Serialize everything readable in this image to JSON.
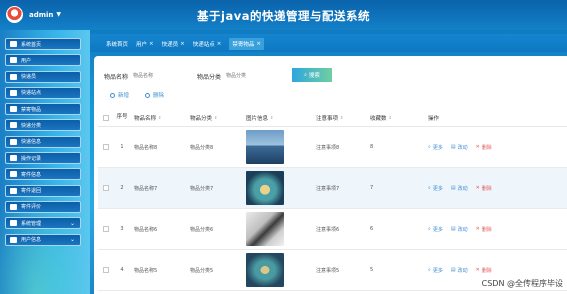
{
  "header": {
    "username": "admin",
    "title": "基于java的快递管理与配送系统"
  },
  "sidebar": {
    "items": [
      {
        "label": "系统首页",
        "icon": "home-icon"
      },
      {
        "label": "用户",
        "icon": "user-icon"
      },
      {
        "label": "快递员",
        "icon": "monitor-icon"
      },
      {
        "label": "快递站点",
        "icon": "person-icon"
      },
      {
        "label": "禁寄物品",
        "icon": "box-icon"
      },
      {
        "label": "快递分类",
        "icon": "chart-icon"
      },
      {
        "label": "快递信息",
        "icon": "list-icon"
      },
      {
        "label": "操作记录",
        "icon": "chat-icon"
      },
      {
        "label": "寄件信息",
        "icon": "calendar-icon"
      },
      {
        "label": "寄件退回",
        "icon": "grid-icon"
      },
      {
        "label": "寄件评价",
        "icon": "grid2-icon"
      },
      {
        "label": "系统管理",
        "icon": "flag-icon"
      },
      {
        "label": "用户信息",
        "icon": "window-icon"
      }
    ]
  },
  "tabs": [
    {
      "label": "系统首页",
      "close": ""
    },
    {
      "label": "用户",
      "close": "×"
    },
    {
      "label": "快递员",
      "close": "×"
    },
    {
      "label": "快递站点",
      "close": "×"
    },
    {
      "label": "禁寄物品",
      "close": "×"
    }
  ],
  "search": {
    "name_label": "物品名称",
    "name_placeholder": "物品名称",
    "category_label": "物品分类",
    "category_placeholder": "物品分类",
    "button": "搜索"
  },
  "actions": {
    "add": "新增",
    "delete": "删除"
  },
  "table": {
    "headers": [
      "序号",
      "物品名称",
      "物品分类",
      "图片信息",
      "注意事项",
      "收藏数",
      "操作"
    ],
    "rows": [
      {
        "index": "1",
        "name": "物品名称8",
        "category": "物品分类8",
        "note": "注意事项8",
        "favorites": "8"
      },
      {
        "index": "2",
        "name": "物品名称7",
        "category": "物品分类7",
        "note": "注意事项7",
        "favorites": "7"
      },
      {
        "index": "3",
        "name": "物品名称6",
        "category": "物品分类6",
        "note": "注意事项6",
        "favorites": "6"
      },
      {
        "index": "4",
        "name": "物品名称5",
        "category": "物品分类5",
        "note": "注意事项5",
        "favorites": "5"
      }
    ],
    "ops": {
      "more": "更多",
      "edit": "改动",
      "delete": "删除"
    }
  },
  "watermark": "CSDN @全传程序毕设"
}
